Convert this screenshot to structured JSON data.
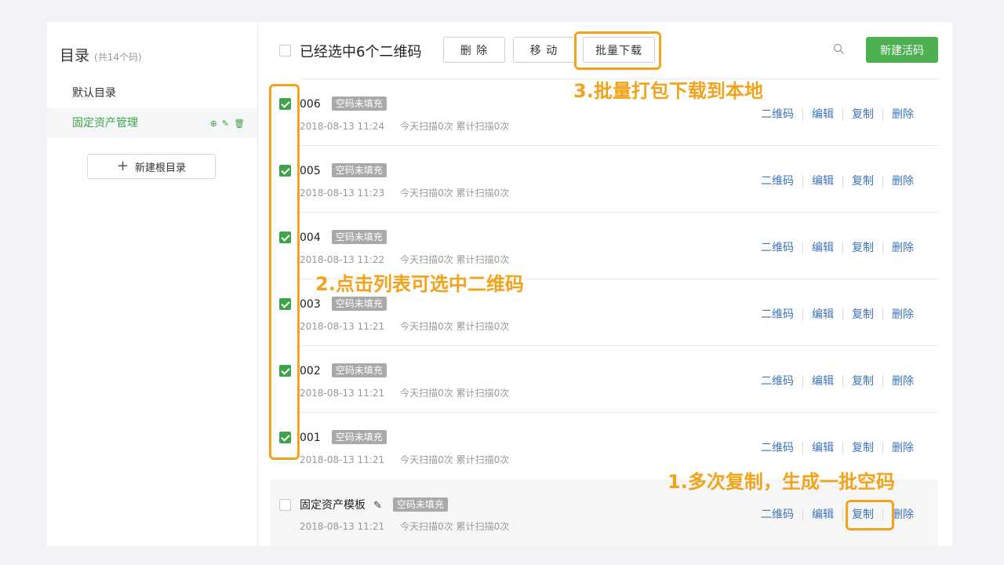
{
  "sidebar": {
    "title": "目录",
    "count": "(共14个码)",
    "items": [
      {
        "label": "默认目录"
      },
      {
        "label": "固定资产管理",
        "actions": [
          "⊕",
          "✎",
          "🗑"
        ]
      }
    ],
    "new_root_label": "新建根目录"
  },
  "toolbar": {
    "selected_text": "已经选中6个二维码",
    "delete_label": "删 除",
    "move_label": "移 动",
    "batch_download_label": "批量下载",
    "new_code_label": "新建活码"
  },
  "rows": [
    {
      "name": "006",
      "tag": "空码未填充",
      "date": "2018-08-13 11:24",
      "stats": "今天扫描0次 累计扫描0次",
      "checked": true
    },
    {
      "name": "005",
      "tag": "空码未填充",
      "date": "2018-08-13 11:23",
      "stats": "今天扫描0次 累计扫描0次",
      "checked": true
    },
    {
      "name": "004",
      "tag": "空码未填充",
      "date": "2018-08-13 11:22",
      "stats": "今天扫描0次 累计扫描0次",
      "checked": true
    },
    {
      "name": "003",
      "tag": "空码未填充",
      "date": "2018-08-13 11:21",
      "stats": "今天扫描0次 累计扫描0次",
      "checked": true
    },
    {
      "name": "002",
      "tag": "空码未填充",
      "date": "2018-08-13 11:21",
      "stats": "今天扫描0次 累计扫描0次",
      "checked": true
    },
    {
      "name": "001",
      "tag": "空码未填充",
      "date": "2018-08-13 11:21",
      "stats": "今天扫描0次 累计扫描0次",
      "checked": true
    },
    {
      "name": "固定资产模板",
      "tag": "空码未填充",
      "date": "2018-08-13 11:21",
      "stats": "今天扫描0次 累计扫描0次",
      "checked": false
    }
  ],
  "row_actions": {
    "qrcode": "二维码",
    "edit": "编辑",
    "copy": "复制",
    "delete": "删除"
  },
  "annotations": {
    "note1": "1.多次复制，生成一批空码",
    "note2": "2.点击列表可选中二维码",
    "note3": "3.批量打包下载到本地"
  },
  "colors": {
    "accent_green": "#3ea34a",
    "annotation_orange": "#f3a31b",
    "link_blue": "#3d74b8"
  }
}
